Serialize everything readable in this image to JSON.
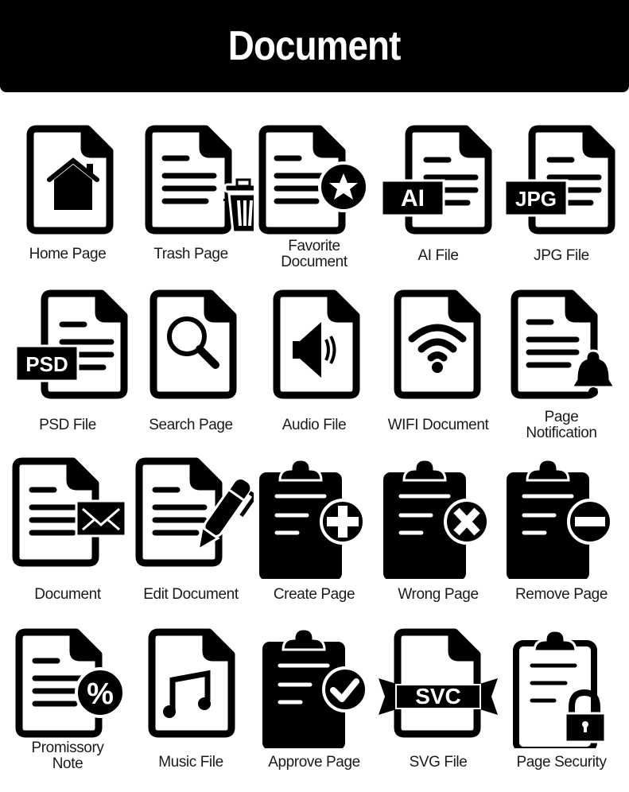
{
  "header": {
    "title": "Document"
  },
  "icons": [
    {
      "label": "Home Page",
      "icon": "home-document-icon"
    },
    {
      "label": "Trash Page",
      "icon": "trash-document-icon"
    },
    {
      "label": "Favorite Document",
      "icon": "favorite-document-icon"
    },
    {
      "label": "AI File",
      "icon": "ai-file-icon",
      "badge": "AI"
    },
    {
      "label": "JPG File",
      "icon": "jpg-file-icon",
      "badge": "JPG"
    },
    {
      "label": "PSD File",
      "icon": "psd-file-icon",
      "badge": "PSD"
    },
    {
      "label": "Search Page",
      "icon": "search-document-icon"
    },
    {
      "label": "Audio File",
      "icon": "audio-file-icon"
    },
    {
      "label": "WIFI Document",
      "icon": "wifi-document-icon"
    },
    {
      "label": "Page Notification",
      "icon": "bell-document-icon"
    },
    {
      "label": "Document",
      "icon": "mail-document-icon"
    },
    {
      "label": "Edit Document",
      "icon": "edit-document-icon"
    },
    {
      "label": "Create Page",
      "icon": "clipboard-plus-icon"
    },
    {
      "label": "Wrong Page",
      "icon": "clipboard-x-icon"
    },
    {
      "label": "Remove Page",
      "icon": "clipboard-minus-icon"
    },
    {
      "label": "Promissory Note",
      "icon": "percent-document-icon",
      "badge": "%"
    },
    {
      "label": "Music File",
      "icon": "music-file-icon"
    },
    {
      "label": "Approve Page",
      "icon": "clipboard-check-icon"
    },
    {
      "label": "SVG File",
      "icon": "svg-file-icon",
      "badge": "SVC"
    },
    {
      "label": "Page Security",
      "icon": "clipboard-lock-icon"
    }
  ]
}
